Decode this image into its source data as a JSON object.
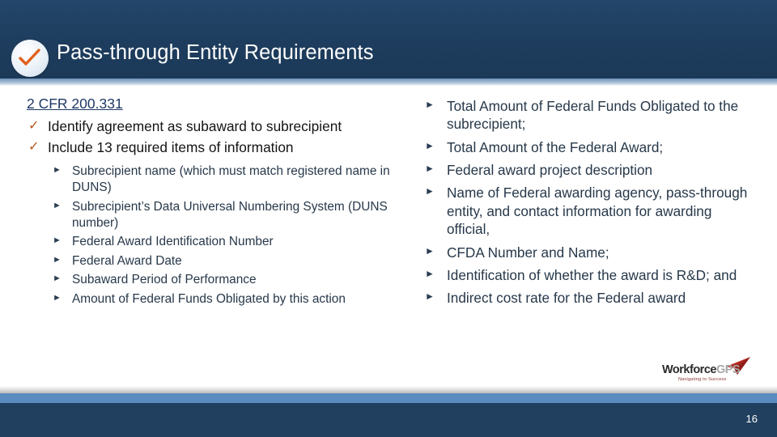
{
  "header": {
    "title": "Pass-through Entity Requirements",
    "badge_icon": "check-circle-icon",
    "bg_color": "#1f4061"
  },
  "left_column": {
    "link": {
      "label": "2 CFR 200.331",
      "color": "#1f3864"
    },
    "check_items": [
      {
        "mark": "✓",
        "text": "Identify agreement as subaward to subrecipient"
      },
      {
        "mark": "✓",
        "text": "Include 13 required items of information"
      }
    ],
    "sub_items": [
      {
        "mark": "►",
        "text": "Subrecipient name (which must match registered name in DUNS)"
      },
      {
        "mark": "►",
        "text": "Subrecipient’s Data Universal Numbering System (DUNS number)"
      },
      {
        "mark": "►",
        "text": "Federal Award Identification Number"
      },
      {
        "mark": "►",
        "text": "Federal Award Date"
      },
      {
        "mark": "►",
        "text": "Subaward Period of Performance"
      },
      {
        "mark": "►",
        "text": "Amount of Federal Funds Obligated by this action"
      }
    ]
  },
  "right_column": {
    "items": [
      {
        "mark": "►",
        "text": "Total Amount of Federal Funds Obligated to the  subrecipient;"
      },
      {
        "mark": "►",
        "text": "Total Amount of the Federal Award;"
      },
      {
        "mark": "►",
        "text": "Federal award project description"
      },
      {
        "mark": "►",
        "text": "Name of Federal awarding agency, pass-through entity, and contact information  for  awarding official,"
      },
      {
        "mark": "►",
        "text": "CFDA Number and Name;"
      },
      {
        "mark": "►",
        "text": "Identification of whether the award is R&D; and"
      },
      {
        "mark": "►",
        "text": "Indirect cost rate for the Federal award"
      }
    ]
  },
  "logo": {
    "word_primary": "Workforce",
    "word_secondary": "GPS",
    "tagline": "Navigating to Success",
    "arrow_color": "#b02a21"
  },
  "footer": {
    "page_number": "16",
    "bar_color": "#213f5e",
    "accent_color": "#5b8cc0"
  }
}
